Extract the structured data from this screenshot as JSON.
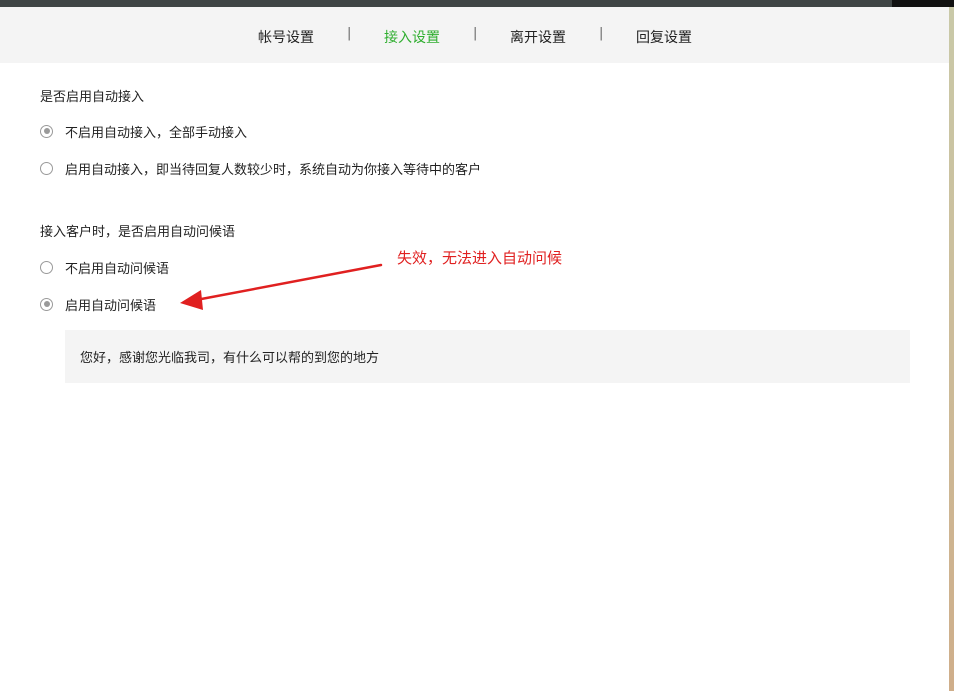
{
  "tabs": [
    {
      "label": "帐号设置",
      "active": false
    },
    {
      "label": "接入设置",
      "active": true
    },
    {
      "label": "离开设置",
      "active": false
    },
    {
      "label": "回复设置",
      "active": false
    }
  ],
  "separator": "|",
  "auto_accept": {
    "title": "是否启用自动接入",
    "options": [
      {
        "label": "不启用自动接入，全部手动接入",
        "checked": true
      },
      {
        "label": "启用自动接入，即当待回复人数较少时，系统自动为你接入等待中的客户",
        "checked": false
      }
    ]
  },
  "auto_greeting": {
    "title": "接入客户时，是否启用自动问候语",
    "options": [
      {
        "label": "不启用自动问候语",
        "checked": false
      },
      {
        "label": "启用自动问候语",
        "checked": true
      }
    ],
    "greeting_text": "您好，感谢您光临我司，有什么可以帮的到您的地方"
  },
  "annotation": {
    "text": "失效，无法进入自动问候",
    "color": "#e02020"
  },
  "colors": {
    "accent": "#2fae2f",
    "topbar": "#3f4545"
  }
}
